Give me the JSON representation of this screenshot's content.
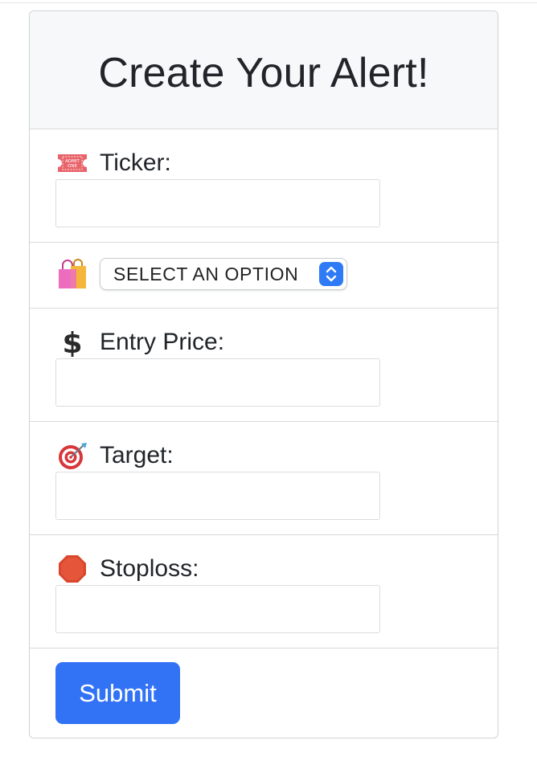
{
  "form": {
    "title": "Create Your Alert!",
    "fields": {
      "ticker": {
        "label": "Ticker:",
        "icon": "admit-one-ticket-icon",
        "value": ""
      },
      "entry_price": {
        "label": "Entry Price:",
        "icon": "dollar-sign-icon",
        "value": ""
      },
      "target": {
        "label": "Target:",
        "icon": "direct-hit-target-icon",
        "value": ""
      },
      "stoploss": {
        "label": "Stoploss:",
        "icon": "octagonal-stop-sign-icon",
        "value": ""
      }
    },
    "select": {
      "icon": "shopping-bags-icon",
      "selected": "SELECT AN OPTION"
    },
    "submit_label": "Submit"
  },
  "colors": {
    "accent": "#3273f6",
    "header_bg": "#f7f8f9",
    "border": "#d6d9dc"
  }
}
